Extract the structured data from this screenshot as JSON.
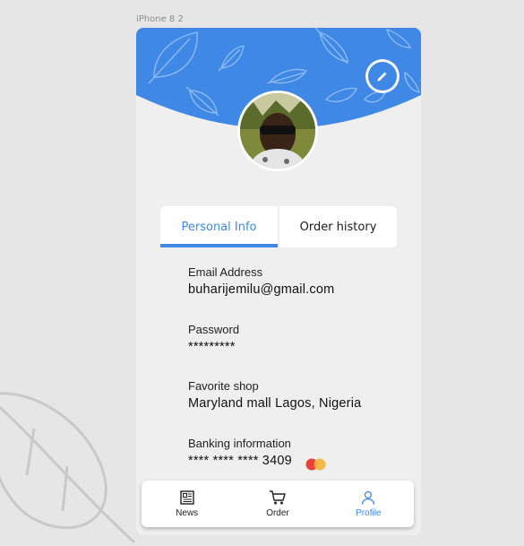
{
  "artboard": {
    "label": "iPhone 8 2"
  },
  "colors": {
    "accent": "#3f88e6",
    "header": "#3f88e6",
    "card": "#ffffff",
    "screen": "#efefef"
  },
  "header": {
    "edit_icon": "pencil-icon",
    "avatar": "profile-photo"
  },
  "tabs": [
    {
      "label": "Personal Info",
      "active": true
    },
    {
      "label": "Order history",
      "active": false
    }
  ],
  "profile": {
    "email_label": "Email Address",
    "email_value": "buharijemilu@gmail.com",
    "password_label": "Password",
    "password_value": "*********",
    "shop_label": "Favorite shop",
    "shop_value": "Maryland mall Lagos, Nigeria",
    "banking_label": "Banking information",
    "banking_value": "**** **** **** 3409",
    "card_icon": "mastercard-icon"
  },
  "nav": [
    {
      "label": "News",
      "icon": "newspaper-icon",
      "active": false
    },
    {
      "label": "Order",
      "icon": "cart-icon",
      "active": false
    },
    {
      "label": "Profile",
      "icon": "user-icon",
      "active": true
    }
  ]
}
